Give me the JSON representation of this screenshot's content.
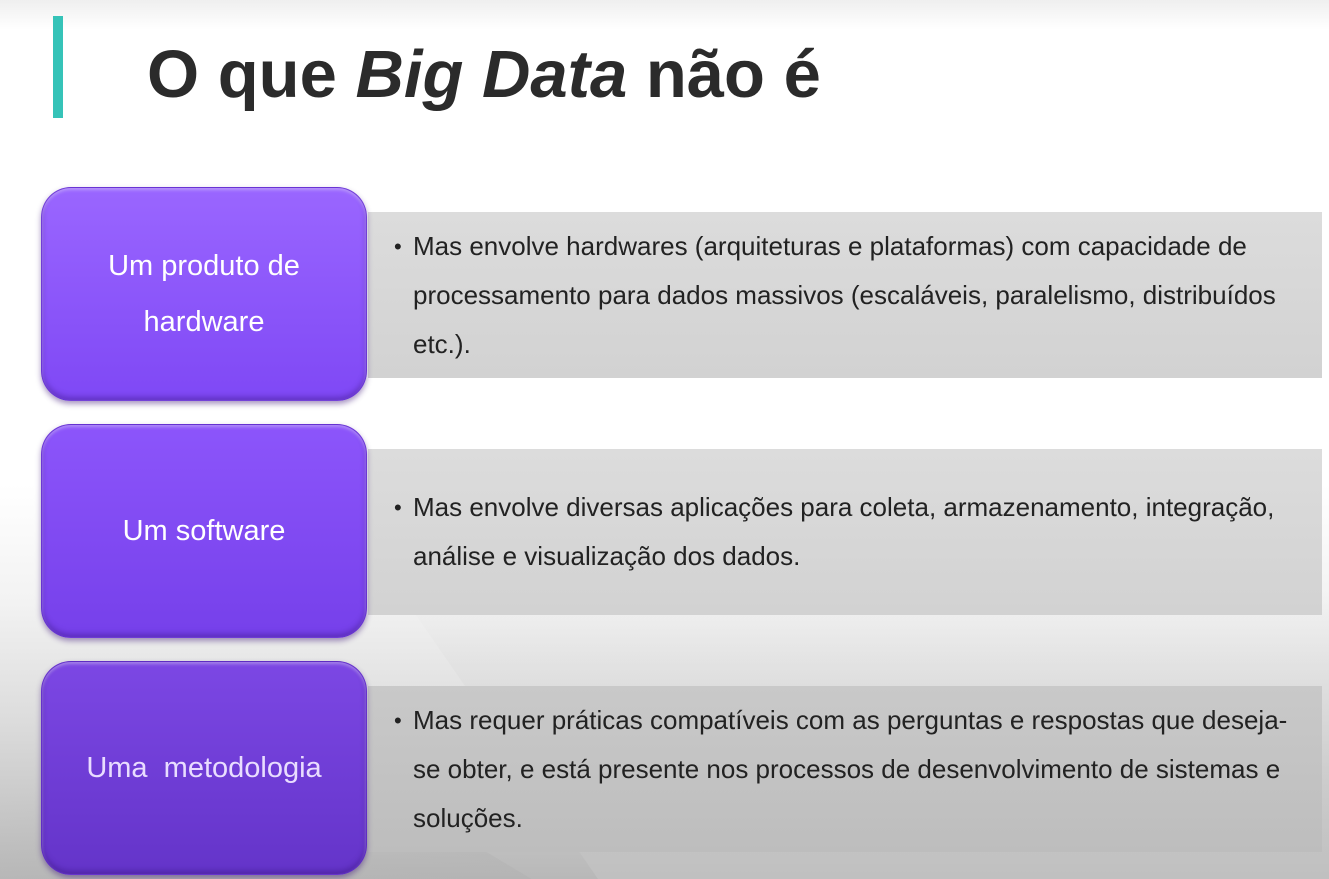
{
  "slide": {
    "title_prefix": "O que ",
    "title_emphasis": "Big Data",
    "title_suffix": " não é",
    "accent_color": "#35c3b8",
    "label_color": "#8a54fb",
    "panel_color": "#d8d8d8"
  },
  "rows": [
    {
      "label": "Um produto de hardware",
      "bullet": "•",
      "text": "Mas envolve hardwares (arquiteturas e plataformas) com capacidade de processamento para dados massivos (escaláveis, paralelismo, distribuídos etc.)."
    },
    {
      "label": "Um software",
      "bullet": "•",
      "text": "Mas envolve diversas aplicações para coleta, armazenamento, integração, análise e visualização dos dados."
    },
    {
      "label": "Uma  metodologia",
      "bullet": "•",
      "text": "Mas requer práticas compatíveis com as perguntas e respostas que deseja-se obter, e está presente nos processos de desenvolvimento de sistemas e soluções."
    }
  ]
}
